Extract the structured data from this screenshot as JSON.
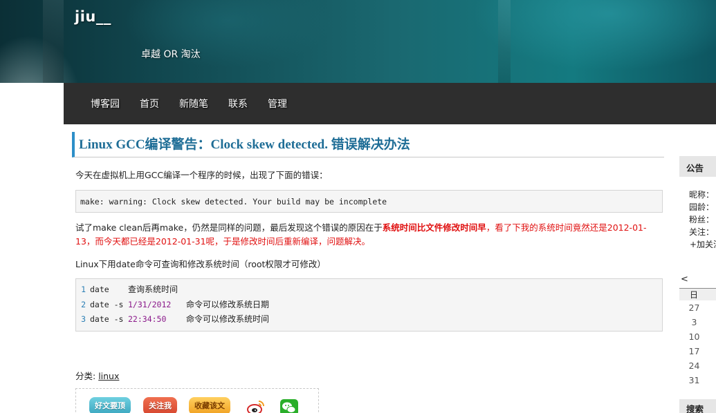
{
  "header": {
    "site_title": "jiu__",
    "subtitle": "卓越 OR 淘汰"
  },
  "nav": {
    "items": [
      "博客园",
      "首页",
      "新随笔",
      "联系",
      "管理"
    ]
  },
  "post": {
    "title": "Linux GCC编译警告：Clock skew detected. 错误解决办法",
    "intro": "今天在虚拟机上用GCC编译一个程序的时候，出现了下面的错误：",
    "error_code": "make: warning: Clock skew detected. Your build may be incomplete",
    "explanation_before": "试了make clean后再make，仍然是同样的问题，最后发现这个错误的原因在于",
    "explanation_bold": "系统时间比文件修改时间早",
    "explanation_after_red": "，看了下我的系统时间竟然还是2012-01-13，而今天都已经是2012-01-31呢，于是修改时间后重新编译，问题解决。",
    "date_intro": "Linux下用date命令可查询和修改系统时间（root权限才可修改）",
    "code_lines": [
      {
        "num": "1",
        "cmd": "date",
        "arg": "",
        "comment": "查询系统时间"
      },
      {
        "num": "2",
        "cmd": "date -s",
        "arg": "1/31/2012",
        "comment": "命令可以修改系统日期"
      },
      {
        "num": "3",
        "cmd": "date -s",
        "arg": "22:34:50",
        "comment": "命令可以修改系统时间"
      }
    ],
    "category_label": "分类: ",
    "category_link": "linux",
    "share": {
      "good_label": "好文要顶",
      "follow_label": "关注我",
      "favorite_label": "收藏该文"
    }
  },
  "sidebar": {
    "notice_title": "公告",
    "profile_lines": [
      "昵称：",
      "园龄：",
      "粉丝：",
      "关注：",
      "+加关注"
    ],
    "calendar_prev": "<",
    "calendar_day_header": "日",
    "calendar_days": [
      "27",
      "3",
      "10",
      "17",
      "24",
      "31"
    ],
    "search_title": "搜索"
  },
  "colors": {
    "nav_bg": "#2e2e2e",
    "title_color": "#1e6d96",
    "title_accent": "#2d8fc8",
    "highlight_red": "#e01010"
  }
}
